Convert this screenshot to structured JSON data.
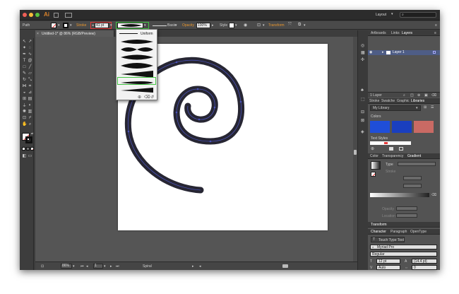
{
  "app": {
    "logo": "Ai",
    "workspace": "Layout",
    "search_placeholder": ""
  },
  "control": {
    "selection": "Path",
    "stroke_label": "Stroke",
    "stroke_weight": "41 pt",
    "brush_label": "Basic",
    "opacity_label": "Opacity",
    "opacity_value": "100%",
    "style_label": "Style",
    "transform_label": "Transform"
  },
  "doc_tab": "Untitled-1* @ 86% (RGB/Preview)",
  "profile_popup": {
    "uniform_label": "Uniform"
  },
  "status": {
    "zoom": "86%",
    "page": "1",
    "selection": "Spiral"
  },
  "panels": {
    "layers_tabs": [
      "Artboards",
      "Links",
      "Layers"
    ],
    "layer_name": "Layer 1",
    "layer_count": "1 Layer",
    "lib_tabs": [
      "Stroke",
      "Swatche",
      "Graphic",
      "Libraries"
    ],
    "library_name": "My Library",
    "colors_title": "Colors",
    "text_styles_title": "Text Styles",
    "grad_tabs": [
      "Color",
      "Transparency",
      "Gradient"
    ],
    "gradient_type_label": "Type",
    "stroke_sub_label": "Stroke",
    "opacity_label": "Opacity",
    "location_label": "Location",
    "transform_tab": "Transform",
    "char_tabs": [
      "Character",
      "Paragraph",
      "OpenType"
    ],
    "touch_type": "Touch Type Tool",
    "font_family": "Myriad Pro",
    "font_style": "Regular",
    "font_size": "12 pt",
    "leading": "(14.4 pt)",
    "kerning": "Auto",
    "tracking": "0"
  },
  "colors": {
    "swatch1": "#1f4ed8",
    "swatch2": "#1a3fbf",
    "swatch3": "#c96a64",
    "spiral": "#272633",
    "spiral_edge": "#3a3f8f",
    "highlight_red": "#e53a3a",
    "highlight_green": "#43c443"
  }
}
